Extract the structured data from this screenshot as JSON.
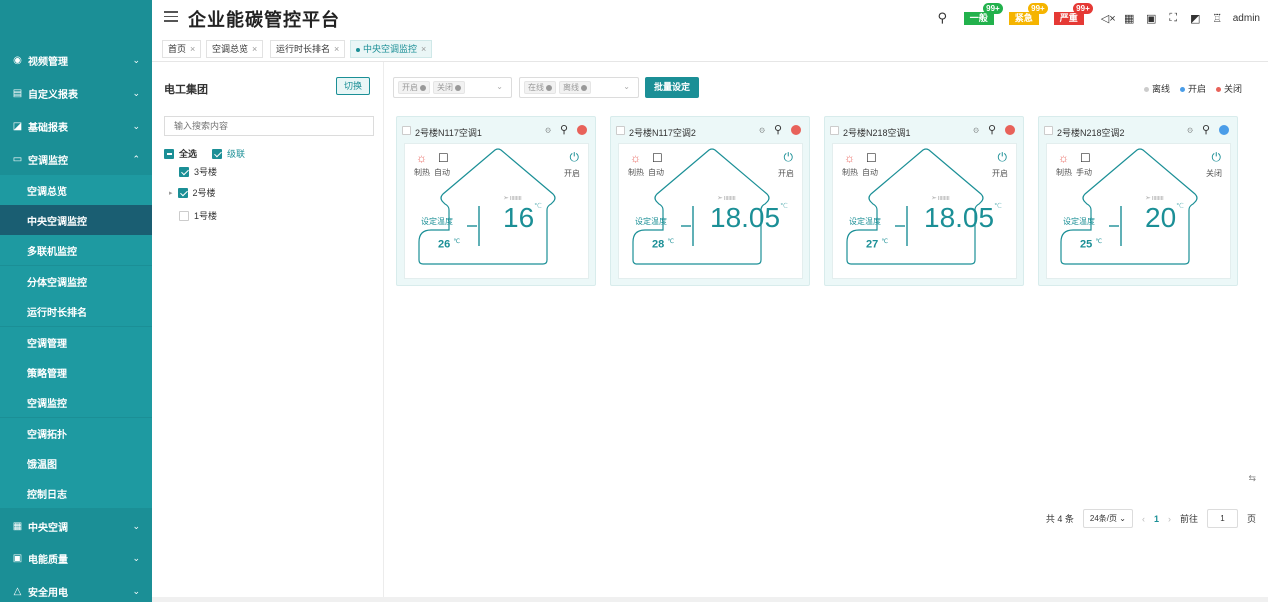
{
  "app": {
    "title": "企业能碳管控平台"
  },
  "topbar": {
    "alarms": [
      {
        "label": "一般",
        "count": "99+",
        "color": "#22b14c"
      },
      {
        "label": "紧急",
        "count": "99+",
        "color": "#f5b400"
      },
      {
        "label": "严重",
        "count": "99+",
        "color": "#e53935"
      }
    ],
    "user": "admin",
    "icons": [
      "search-icon",
      "mute-icon",
      "grid-icon",
      "screen-icon",
      "fullscreen-icon",
      "translate-icon",
      "shirt-icon"
    ]
  },
  "sidebar": {
    "items": [
      {
        "label": "视频管理",
        "icon": "video-icon"
      },
      {
        "label": "自定义报表",
        "icon": "report-icon"
      },
      {
        "label": "基础报表",
        "icon": "chart-icon"
      },
      {
        "label": "空调监控",
        "icon": "ac-icon",
        "expanded": true
      }
    ],
    "sub": [
      "空调总览",
      "中央空调监控",
      "多联机监控",
      "分体空调监控",
      "运行时长排名",
      "空调管理",
      "策略管理",
      "空调监控",
      "空调拓扑",
      "饿温图",
      "控制日志"
    ],
    "bottom": [
      {
        "label": "中央空调",
        "icon": "central-ac-icon"
      },
      {
        "label": "电能质量",
        "icon": "power-quality-icon"
      },
      {
        "label": "安全用电",
        "icon": "safety-icon"
      }
    ]
  },
  "tabs": [
    {
      "label": "首页"
    },
    {
      "label": "空调总览"
    },
    {
      "label": "运行时长排名"
    },
    {
      "label": "中央空调监控",
      "active": true
    }
  ],
  "left": {
    "title": "电工集团",
    "switch": "切换",
    "search_placeholder": "输入搜索内容",
    "select_all": "全选",
    "cascade": "级联",
    "tree": [
      "3号楼",
      "2号楼",
      "1号楼"
    ]
  },
  "filters": {
    "power": [
      "开启",
      "关闭"
    ],
    "online": [
      "在线",
      "离线"
    ],
    "batch": "批量设定"
  },
  "legend": [
    {
      "label": "离线",
      "color": "#cccccc"
    },
    {
      "label": "开启",
      "color": "#4a9de8"
    },
    {
      "label": "关闭",
      "color": "#e8625a"
    }
  ],
  "cards": [
    {
      "name": "2号楼N117空调1",
      "status_color": "#e8625a",
      "mode": "制热",
      "auto": "自动",
      "power": "开启",
      "set_label": "设定温度",
      "set": "26",
      "unit": "℃",
      "temp": "16"
    },
    {
      "name": "2号楼N117空调2",
      "status_color": "#e8625a",
      "mode": "制热",
      "auto": "自动",
      "power": "开启",
      "set_label": "设定温度",
      "set": "28",
      "unit": "℃",
      "temp": "18.05"
    },
    {
      "name": "2号楼N218空调1",
      "status_color": "#e8625a",
      "mode": "制热",
      "auto": "自动",
      "power": "开启",
      "set_label": "设定温度",
      "set": "27",
      "unit": "℃",
      "temp": "18.05"
    },
    {
      "name": "2号楼N218空调2",
      "status_color": "#4a9de8",
      "mode": "制热",
      "auto": "手动",
      "power": "关闭",
      "set_label": "设定温度",
      "set": "25",
      "unit": "℃",
      "temp": "20"
    }
  ],
  "pager": {
    "total": "共 4 条",
    "size": "24条/页",
    "page": "1",
    "goto": "前往",
    "page_val": "1",
    "page_unit": "页"
  }
}
